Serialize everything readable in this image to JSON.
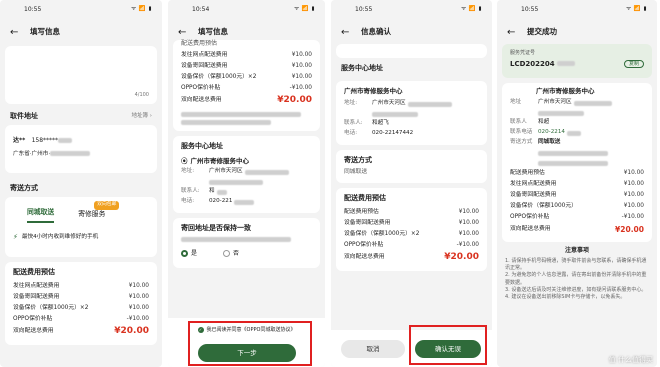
{
  "status": {
    "time1": "10:55",
    "time2": "10:54",
    "time3": "10:55",
    "time4": "10:55",
    "icons": "ᯤ 📶 ▮"
  },
  "screen1": {
    "title": "填写信息",
    "counter": "4/100",
    "address_label": "取件地址",
    "address_change": "地址簿",
    "contact_name": "达**",
    "contact_phone": "158*****",
    "region": "广东省·广州市·",
    "method_title": "寄送方式",
    "tab_local": "同城取送",
    "tab_mail": "寄修服务",
    "badge": "双向包邮",
    "tip": "最快4小时内收到维修好的手机",
    "fee_title": "配送费用预估",
    "fees": [
      {
        "label": "发往网点配送费用",
        "value": "¥10.00"
      },
      {
        "label": "设备寄回配送费用",
        "value": "¥10.00"
      },
      {
        "label": "设备保价（保额1000元）×2",
        "value": "¥10.00"
      },
      {
        "label": "OPPO保价补贴",
        "value": "-¥10.00"
      }
    ],
    "total_label": "双向配送总费用",
    "total_value": "¥20.00"
  },
  "screen2": {
    "title": "填写信息",
    "fee_heading": "配送费用预估",
    "fees": [
      {
        "label": "发往网点配送费用",
        "value": "¥10.00"
      },
      {
        "label": "设备寄回配送费用",
        "value": "¥10.00"
      },
      {
        "label": "设备保价（保额1000元）×2",
        "value": "¥10.00"
      },
      {
        "label": "OPPO保价补贴",
        "value": "-¥10.00"
      }
    ],
    "total_label": "双向配送总费用",
    "total_value": "¥20.00",
    "center_title": "服务中心地址",
    "center_name": "广州市寄修服务中心",
    "addr_label": "地址:",
    "addr_value": "广州市天河区",
    "contact_label": "联系人:",
    "contact_value": "和",
    "phone_label": "电话:",
    "phone_value": "020-221",
    "return_question": "寄回地址是否保持一致",
    "yes": "是",
    "no": "否",
    "agree_text": "我已阅读并同意《OPPO同城取送协议》",
    "next_btn": "下一步"
  },
  "screen3": {
    "title": "信息确认",
    "center_title": "服务中心地址",
    "center_name": "广州市寄修服务中心",
    "addr_label": "地址:",
    "addr_value": "广州市天河区",
    "contact_label": "联系人:",
    "contact_value": "和超飞",
    "phone_label": "电话:",
    "phone_value": "020-22147442",
    "method_title": "寄送方式",
    "method_value": "同城取送",
    "fee_title": "配送费用预估",
    "fees": [
      {
        "label": "配送费用预估",
        "value": "¥10.00"
      },
      {
        "label": "设备寄回配送费用",
        "value": "¥10.00"
      },
      {
        "label": "设备保价（保额1000元）×2",
        "value": "¥10.00"
      },
      {
        "label": "OPPO保价补贴",
        "value": "-¥10.00"
      }
    ],
    "total_label": "双向配送总费用",
    "total_value": "¥20.00",
    "cancel_btn": "取消",
    "confirm_btn": "确认无误"
  },
  "screen4": {
    "title": "提交成功",
    "voucher_label": "服务凭证号",
    "voucher_value": "LCD202204",
    "copy_btn": "复制",
    "center_name": "广州市寄修服务中心",
    "addr_label": "地址",
    "addr_value": "广州市天河区",
    "contact_label": "联系人",
    "contact_value": "和超",
    "phone_label": "联系电话",
    "phone_value": "020-2214",
    "method_label": "寄送方式",
    "method_value": "同城取送",
    "fees": [
      {
        "label": "配送费用预估",
        "value": "¥10.00"
      },
      {
        "label": "发往网点配送费用",
        "value": "¥10.00"
      },
      {
        "label": "设备寄回配送费用",
        "value": "¥10.00"
      },
      {
        "label": "设备保价（保额1000元）",
        "value": "¥10.00"
      },
      {
        "label": "OPPO保价补贴",
        "value": "-¥10.00"
      }
    ],
    "total_label": "双向配送总费用",
    "total_value": "¥20.00",
    "notice_title": "注意事项",
    "notices": [
      "1. 请保持手机号码畅通，骑手取件前会与您联系，请确保手机通讯正常。",
      "2. 为避免您的个人信息泄露，请在寄出前备份并清除手机中的重要数据。",
      "3. 设备送达后请及时关注维修进度，如有疑问请联系服务中心。",
      "4. 建议在设备送出前移除SIM卡与存储卡，以免丢失。"
    ],
    "watermark": "值 什么值得买"
  }
}
